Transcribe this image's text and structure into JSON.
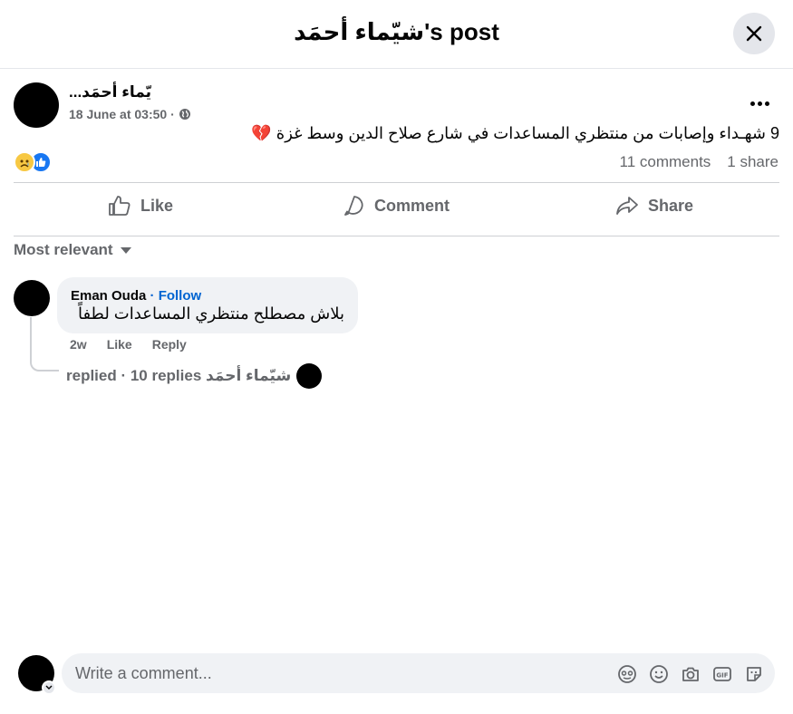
{
  "header": {
    "title": "شيّماء أحمَد's post",
    "close_icon": "close-icon"
  },
  "post": {
    "author_name": "...يّماء أحمَد",
    "timestamp": "18 June at 03:50",
    "audience_icon": "globe-icon",
    "text": "9 شهـداء وإصابات من منتظري المساعدات في شارع صلاح الدين وسط غزة 💔",
    "reactions": [
      "sad-reaction-icon",
      "like-reaction-icon"
    ],
    "comments_count": "11 comments",
    "shares_count": "1 share"
  },
  "actions": {
    "like": "Like",
    "comment": "Comment",
    "share": "Share"
  },
  "sort": {
    "label": "Most relevant"
  },
  "comment": {
    "author": "Eman Ouda",
    "follow": "· Follow",
    "text": "بلاش مصطلح منتظري المساعدات لطفاً",
    "age": "2w",
    "like": "Like",
    "reply": "Reply",
    "replies_summary": "شيّماء أحمَد replied · 10 replies"
  },
  "composer": {
    "placeholder": "Write a comment...",
    "icons": [
      "avatar-sticker-icon",
      "emoji-icon",
      "camera-icon",
      "gif-icon",
      "sticker-icon"
    ]
  },
  "colors": {
    "accent": "#1877f2",
    "link": "#0064d1",
    "secondary_text": "#65676b",
    "surface": "#f0f2f5"
  }
}
